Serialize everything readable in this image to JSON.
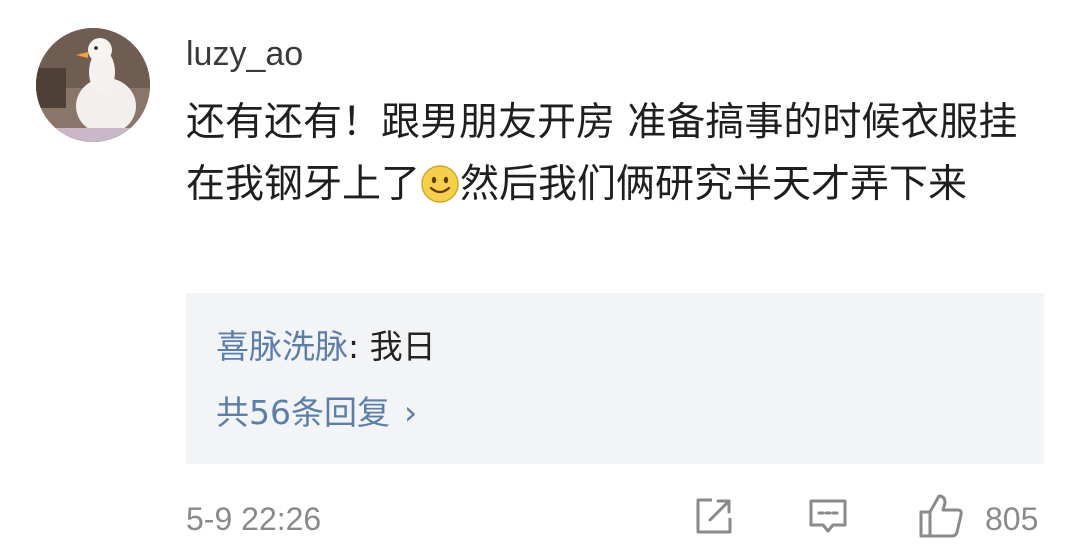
{
  "comment": {
    "username": "luzy_ao",
    "text_part1": "还有还有！跟男朋友开房  准备搞事的时候衣服挂在我钢牙上了",
    "emoji_icon": "smile-emoji",
    "text_part2": "然后我们俩研究半天才弄下来",
    "timestamp": "5-9 22:26",
    "like_count": "805"
  },
  "replies": {
    "top_reply_author": "喜脉洗脉",
    "top_reply_separator": ": ",
    "top_reply_text": "我日",
    "reply_count_label": "共56条回复",
    "chevron": "›"
  },
  "actions": {
    "share_icon": "share-icon",
    "comment_icon": "comment-icon",
    "like_icon": "thumbs-up-icon"
  },
  "colors": {
    "link": "#5a7fab",
    "meta": "#8a8a8a",
    "reply_bg": "#f3f4f6"
  }
}
